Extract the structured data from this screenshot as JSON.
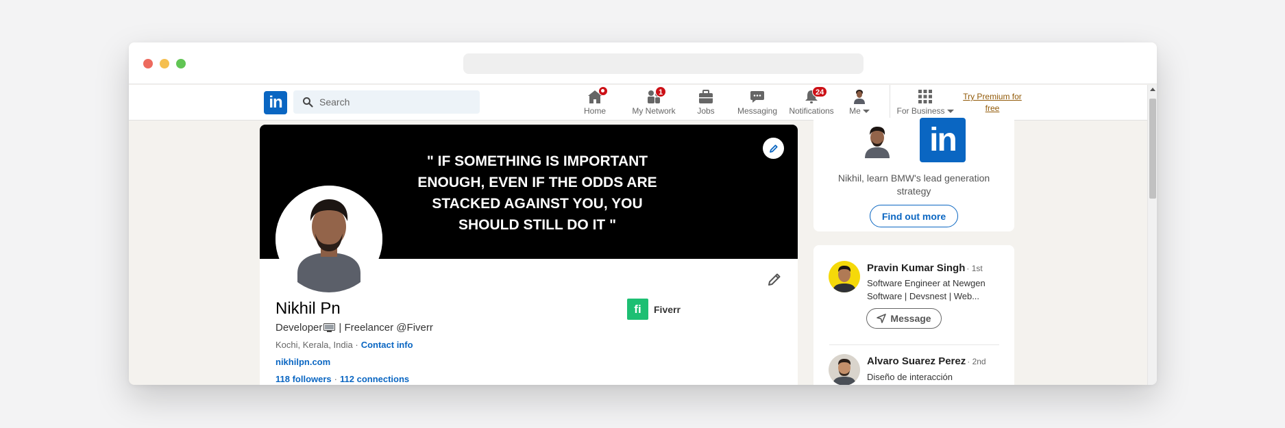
{
  "navbar": {
    "logo_text": "in",
    "search_placeholder": "Search",
    "items": [
      {
        "label": "Home",
        "badge": ""
      },
      {
        "label": "My Network",
        "badge": "1"
      },
      {
        "label": "Jobs",
        "badge": ""
      },
      {
        "label": "Messaging",
        "badge": ""
      },
      {
        "label": "Notifications",
        "badge": "24"
      },
      {
        "label": "Me",
        "badge": ""
      },
      {
        "label": "For Business",
        "badge": ""
      }
    ],
    "premium_label": "Try Premium for free"
  },
  "profile": {
    "banner_quote": "\" IF SOMETHING IS IMPORTANT ENOUGH, EVEN IF THE ODDS ARE STACKED AGAINST YOU, YOU SHOULD STILL DO IT \"",
    "name": "Nikhil Pn",
    "headline_prefix": "Developer",
    "headline_suffix": "| Freelancer @Fiverr",
    "location": "Kochi, Kerala, India ·",
    "contact_info": "Contact info",
    "website": "nikhilpn.com",
    "followers": "118 followers",
    "separator": "·",
    "connections": "112 connections",
    "company": {
      "logo_text": "fi",
      "name": "Fiverr"
    }
  },
  "ad": {
    "logo_text": "in",
    "text": "Nikhil, learn BMW's lead generation strategy",
    "button": "Find out more"
  },
  "people": [
    {
      "name": "Pravin Kumar Singh",
      "degree": "· 1st",
      "title": "Software Engineer at Newgen Software | Devsnest | Web...",
      "button": "Message"
    },
    {
      "name": "Alvaro Suarez Perez",
      "degree": "· 2nd",
      "title": "Diseño de interacción"
    }
  ],
  "colors": {
    "accent": "#0a66c2",
    "badge": "#cc1016",
    "premium": "#915907",
    "fiverr": "#1dbf73"
  }
}
